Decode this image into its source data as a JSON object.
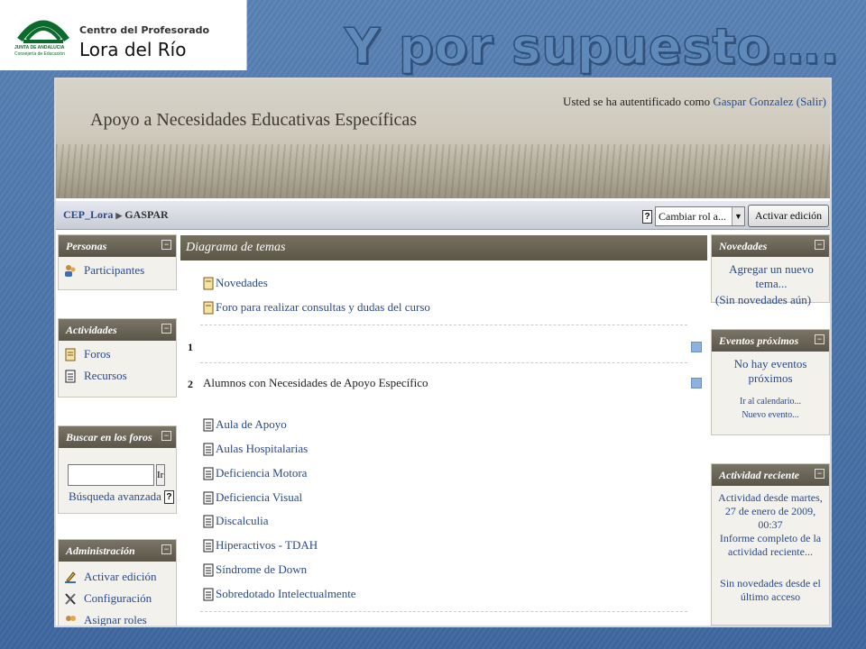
{
  "slide": {
    "title": "Y por supuesto….",
    "logo": {
      "emblem_text_1": "JUNTA DE ANDALUCIA",
      "emblem_text_2": "Consejería de Educación",
      "line1": "Centro del Profesorado",
      "line2": "Lora del Río"
    }
  },
  "header": {
    "course_title": "Apoyo a Necesidades Educativas Específicas",
    "login_prefix": "Usted se ha autentificado como",
    "user_name": "Gaspar Gonzalez",
    "logout_label": "(Salir)"
  },
  "navbar": {
    "crumb_home": "CEP_Lora",
    "crumb_current": "GASPAR",
    "help": "?",
    "role_select_value": "Cambiar rol a...",
    "edit_button": "Activar edición"
  },
  "left_blocks": {
    "personas": {
      "title": "Personas",
      "items": [
        "Participantes"
      ]
    },
    "actividades": {
      "title": "Actividades",
      "items": [
        "Foros",
        "Recursos"
      ]
    },
    "buscar": {
      "title": "Buscar en los foros",
      "go": "Ir",
      "advanced": "Búsqueda avanzada",
      "input_value": ""
    },
    "admin": {
      "title": "Administración",
      "items": [
        "Activar edición",
        "Configuración",
        "Asignar roles"
      ]
    }
  },
  "center": {
    "title": "Diagrama de temas",
    "top_items": [
      "Novedades",
      "Foro para realizar consultas y dudas del curso"
    ],
    "section1_num": "1",
    "section2_num": "2",
    "section2_title": "Alumnos con Necesidades de Apoyo Específico",
    "section2_items": [
      "Aula de Apoyo",
      "Aulas Hospitalarias",
      "Deficiencia Motora",
      "Deficiencia Visual",
      "Discalculia",
      "Hiperactivos - TDAH",
      "Síndrome de Down",
      "Sobredotado Intelectualmente"
    ]
  },
  "right_blocks": {
    "novedades": {
      "title": "Novedades",
      "add_link": "Agregar un nuevo tema...",
      "none": "(Sin novedades aún)"
    },
    "eventos": {
      "title": "Eventos próximos",
      "none": "No hay eventos próximos",
      "calendar": "Ir al calendario...",
      "new_event": "Nuevo evento..."
    },
    "reciente": {
      "title": "Actividad reciente",
      "since": "Actividad desde martes, 27 de enero de 2009, 00:37",
      "report": "Informe completo de la actividad reciente...",
      "none": "Sin novedades desde el último acceso"
    }
  },
  "colors": {
    "accent": "#2a4a8a",
    "block_header": "#5a5548",
    "slide_bg": "#4a73a6"
  }
}
